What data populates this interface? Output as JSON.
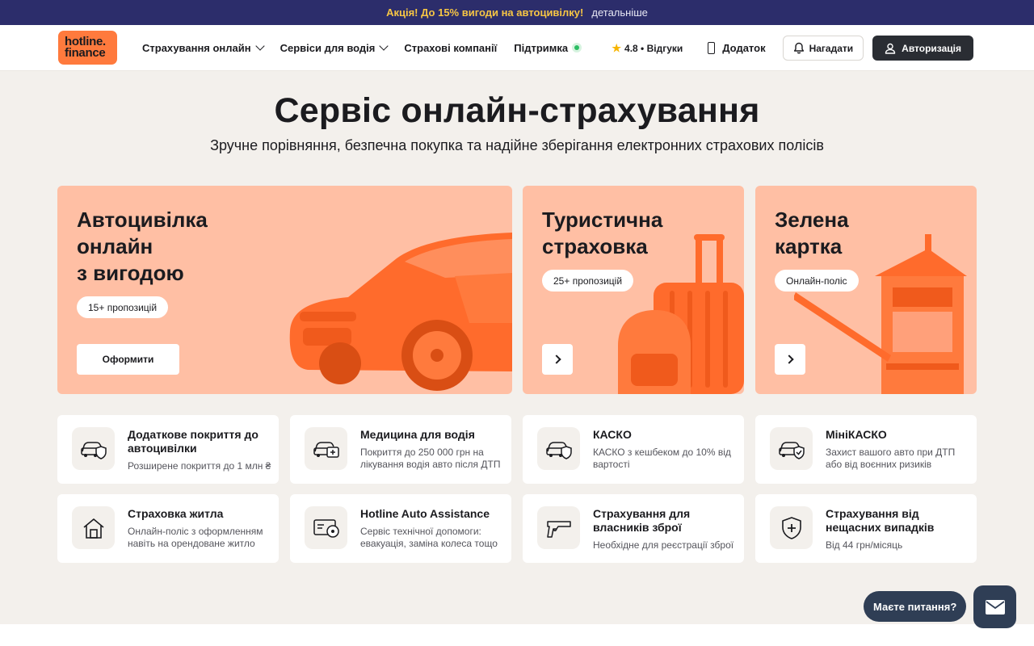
{
  "promo": {
    "text": "Акція! До 15% вигоди на автоцивілку!",
    "link": "детальніше"
  },
  "header": {
    "logo_line1": "hotline.",
    "logo_line2": "finance",
    "nav": [
      {
        "label": "Страхування онлайн"
      },
      {
        "label": "Сервіси для водія"
      },
      {
        "label": "Страхові компанії"
      },
      {
        "label": "Підтримка"
      }
    ],
    "rating": "4.8 • Відгуки",
    "app": "Додаток",
    "remind": "Нагадати",
    "auth": "Авторизація"
  },
  "hero": {
    "title": "Сервіс онлайн-страхування",
    "subtitle": "Зручне порівняння, безпечна покупка та надійне зберігання електронних страхових полісів"
  },
  "cards": [
    {
      "title": "Автоцивілка\nонлайн\nз вигодою",
      "pill": "15+ пропозицій",
      "cta": "Оформити"
    },
    {
      "title": "Туристична\nстраховка",
      "pill": "25+ пропозицій"
    },
    {
      "title": "Зелена\nкартка",
      "pill": "Онлайн-поліс"
    }
  ],
  "services": [
    {
      "title": "Додаткове покриття до автоцивілки",
      "desc": "Розширене покриття до 1 млн ₴",
      "icon": "car-shield-icon"
    },
    {
      "title": "Медицина для водія",
      "desc": "Покриття до 250 000 грн на лікування водія авто після ДТП",
      "icon": "car-medical-icon"
    },
    {
      "title": "КАСКО",
      "desc": "КАСКО з кешбеком до 10% від вартості",
      "icon": "car-shield-icon"
    },
    {
      "title": "МініКАСКО",
      "desc": "Захист вашого авто при ДТП або від воєнних ризиків",
      "icon": "car-check-icon"
    },
    {
      "title": "Страховка житла",
      "desc": "Онлайн-поліс з оформленням навіть на орендоване житло",
      "icon": "house-icon"
    },
    {
      "title": "Hotline Auto Assistance",
      "desc": "Сервіс технічної допомоги: евакуація, заміна колеса тощо",
      "icon": "wheel-card-icon"
    },
    {
      "title": "Страхування для власників зброї",
      "desc": "Необхідне для реєстрації зброї",
      "icon": "gun-icon"
    },
    {
      "title": "Страхування від нещасних випадків",
      "desc": "Від 44 грн/місяць",
      "icon": "medical-shield-icon"
    }
  ],
  "chat": {
    "label": "Маєте питання?"
  },
  "colors": {
    "accent": "#ff7a3d",
    "card_bg": "#ffbfa4",
    "promo_bg": "#2c2d6b",
    "promo_text": "#f7c644",
    "dark": "#2a2d33"
  }
}
